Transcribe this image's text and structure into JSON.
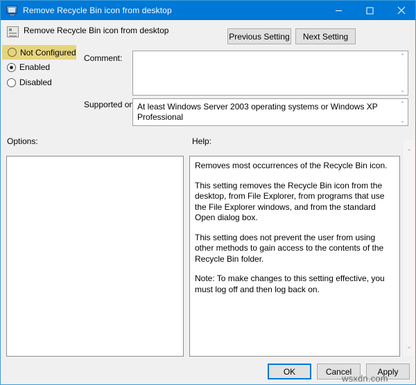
{
  "window": {
    "title": "Remove Recycle Bin icon from desktop",
    "icon": "monitor-policy-icon",
    "controls": {
      "minimize": "minimize-icon",
      "maximize": "maximize-icon",
      "close": "close-icon"
    },
    "accent_color": "#0078d7",
    "border_color": "#3d9ad8",
    "body_color": "#f0f0f0"
  },
  "header": {
    "title": "Remove Recycle Bin icon from desktop",
    "icon": "policy-setting-icon",
    "previous_setting_label": "Previous Setting",
    "next_setting_label": "Next Setting"
  },
  "settings": {
    "options": [
      {
        "label": "Not Configured",
        "selected": false,
        "highlighted": true
      },
      {
        "label": "Enabled",
        "selected": true,
        "highlighted": false
      },
      {
        "label": "Disabled",
        "selected": false,
        "highlighted": false
      }
    ],
    "highlight_color": "#e7d57d"
  },
  "fields": {
    "comment_label": "Comment:",
    "comment_value": "",
    "supported_on_label": "Supported on:",
    "supported_on_value": "At least Windows Server 2003 operating systems or Windows XP Professional"
  },
  "panels": {
    "options_label": "Options:",
    "options_content": "",
    "help_label": "Help:",
    "help_paragraphs": [
      "Removes most occurrences of the Recycle Bin icon.",
      "This setting removes the Recycle Bin icon from the desktop, from File Explorer, from programs that use the File Explorer windows, and from the standard Open dialog box.",
      "This setting does not prevent the user from using other methods to gain access to the contents of the Recycle Bin folder.",
      "Note: To make changes to this setting effective, you must log off and then log back on."
    ]
  },
  "footer": {
    "ok_label": "OK",
    "cancel_label": "Cancel",
    "apply_label": "Apply"
  },
  "watermark": "wsxdn.com",
  "scroll": {
    "up_arrow": "⌃",
    "down_arrow": "⌄"
  }
}
